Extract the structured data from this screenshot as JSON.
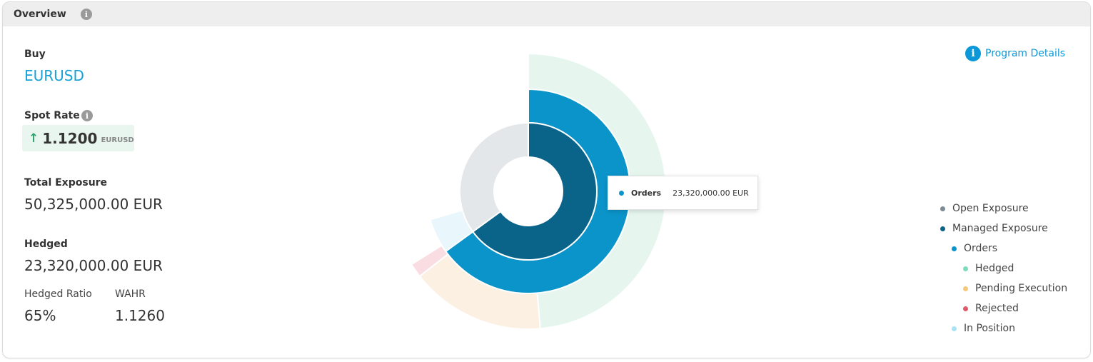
{
  "panel": {
    "title": "Overview",
    "info_glyph": "i"
  },
  "summary": {
    "side": "Buy",
    "pair": "EURUSD",
    "spot_rate_label": "Spot Rate",
    "spot_arrow": "↑",
    "spot_rate": "1.1200",
    "spot_rate_unit": "EURUSD",
    "total_exposure_label": "Total Exposure",
    "total_exposure": "50,325,000.00 EUR",
    "hedged_label": "Hedged",
    "hedged": "23,320,000.00 EUR",
    "hedged_ratio_label": "Hedged Ratio",
    "hedged_ratio": "65%",
    "wahr_label": "WAHR",
    "wahr": "1.1260"
  },
  "program_details": {
    "label": "Program Details",
    "icon": "info-icon"
  },
  "tooltip": {
    "name": "Orders",
    "value": "23,320,000.00 EUR",
    "color": "#0b94c9"
  },
  "legend": [
    {
      "label": "Open Exposure",
      "color": "#7c8b96",
      "level": 0
    },
    {
      "label": "Managed Exposure",
      "color": "#0a6489",
      "level": 0
    },
    {
      "label": "Orders",
      "color": "#0b94c9",
      "level": 1
    },
    {
      "label": "Hedged",
      "color": "#7fdcbb",
      "level": 2
    },
    {
      "label": "Pending Execution",
      "color": "#f5c97c",
      "level": 2
    },
    {
      "label": "Rejected",
      "color": "#e05a6a",
      "level": 2
    },
    {
      "label": "In Position",
      "color": "#a9e3f6",
      "level": 1
    }
  ],
  "colors": {
    "accent": "#0b97d8",
    "positive": "#2fa36b",
    "open_exposure_ring": "#e4e7ea",
    "managed_exposure_ring": "#0a6489",
    "orders_ring": "#0b94c9",
    "hedged_ring": "#e6f6ef",
    "pending_ring": "#fcf0e2",
    "rejected_ring": "#fadde2",
    "in_position_ring": "#e9f6fc"
  }
}
